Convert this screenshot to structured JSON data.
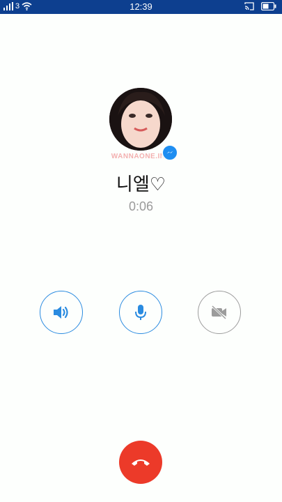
{
  "status_bar": {
    "network": "3",
    "time": "12:39",
    "icons": [
      "signal-icon",
      "wifi-icon",
      "cast-icon",
      "battery-icon"
    ]
  },
  "caller": {
    "name": "니엘♡",
    "duration": "0:06",
    "avatar_watermark": "WANNAONE.INA",
    "badge_icon": "messenger-icon"
  },
  "controls": [
    {
      "icon": "speaker-icon",
      "active": true
    },
    {
      "icon": "microphone-icon",
      "active": true
    },
    {
      "icon": "video-off-icon",
      "active": false
    }
  ],
  "end_call": {
    "icon": "phone-hangup-icon"
  },
  "colors": {
    "status_bar": "#0d3f8f",
    "accent_blue": "#2a8be0",
    "inactive_gray": "#9c9c9c",
    "end_call_red": "#ec3a29",
    "background": "#fdfffd"
  }
}
